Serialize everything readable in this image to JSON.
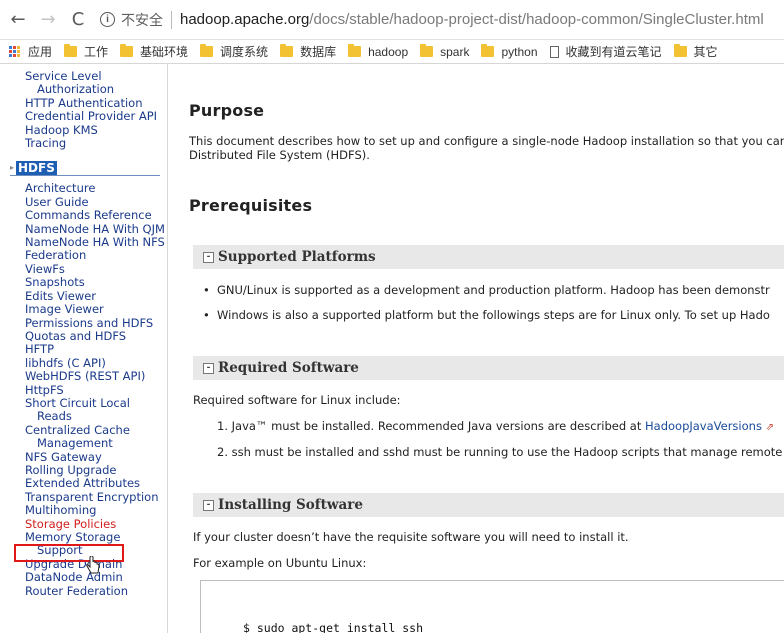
{
  "browser": {
    "back": "←",
    "forward": "→",
    "reload": "C",
    "security_label": "不安全",
    "url_host": "hadoop.apache.org",
    "url_path": "/docs/stable/hadoop-project-dist/hadoop-common/SingleCluster.html"
  },
  "bookmarks": [
    "应用",
    "工作",
    "基础环境",
    "调度系统",
    "数据库",
    "hadoop",
    "spark",
    "python",
    "收藏到有道云笔记",
    "其它"
  ],
  "sidebar": {
    "top_items": [
      "Service Level Authorization",
      "HTTP Authentication",
      "Credential Provider API",
      "Hadoop KMS",
      "Tracing"
    ],
    "section_title": "HDFS",
    "hdfs_items": [
      "Architecture",
      "User Guide",
      "Commands Reference",
      "NameNode HA With QJM",
      "NameNode HA With NFS",
      "Federation",
      "ViewFs",
      "Snapshots",
      "Edits Viewer",
      "Image Viewer",
      "Permissions and HDFS",
      "Quotas and HDFS",
      "HFTP",
      "libhdfs (C API)",
      "WebHDFS (REST API)",
      "HttpFS",
      "Short Circuit Local Reads",
      "Centralized Cache Management",
      "NFS Gateway",
      "Rolling Upgrade",
      "Extended Attributes",
      "Transparent Encryption",
      "Multihoming",
      "Storage Policies",
      "Memory Storage Support",
      "Upgrade Domain",
      "DataNode Admin",
      "Router Federation"
    ],
    "active_item": "Storage Policies"
  },
  "content": {
    "purpose_title": "Purpose",
    "purpose_line1": "This document describes how to set up and configure a single-node Hadoop installation so that you car",
    "purpose_line2": "Distributed File System (HDFS).",
    "prereq_title": "Prerequisites",
    "supported_title": "Supported Platforms",
    "supported_1": "GNU/Linux is supported as a development and production platform. Hadoop has been demonstr",
    "supported_2": "Windows is also a supported platform but the followings steps are for Linux only. To set up Hado",
    "required_title": "Required Software",
    "required_intro": "Required software for Linux include:",
    "required_1_prefix": "1. Java™ must be installed. Recommended Java versions are described at ",
    "required_1_link": "HadoopJavaVersions",
    "required_2": "2. ssh must be installed and sshd must be running to use the Hadoop scripts that manage remote",
    "installing_title": "Installing Software",
    "installing_line": "If your cluster doesn’t have the requisite software you will need to install it.",
    "ubuntu_line": "For example on Ubuntu Linux:",
    "code_line": "$ sudo apt-get install ssh"
  }
}
